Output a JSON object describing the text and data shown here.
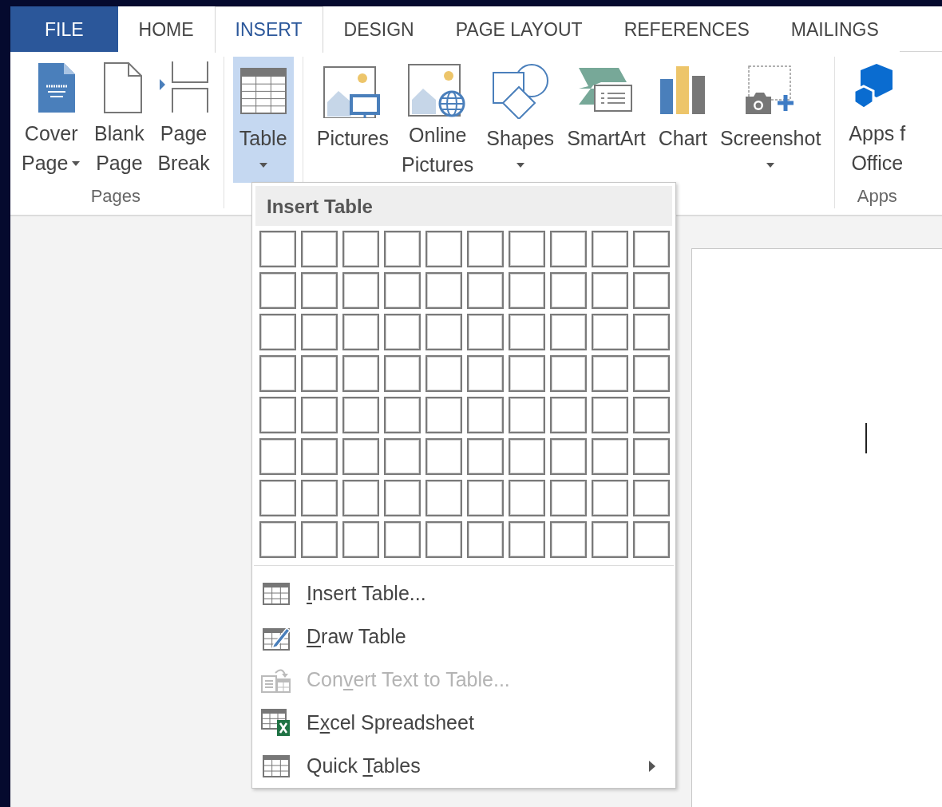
{
  "tabs": [
    {
      "label": "FILE",
      "kind": "file",
      "selected": false
    },
    {
      "label": "HOME",
      "kind": "tab",
      "selected": false
    },
    {
      "label": "INSERT",
      "kind": "tab",
      "selected": true
    },
    {
      "label": "DESIGN",
      "kind": "tab",
      "selected": false
    },
    {
      "label": "PAGE LAYOUT",
      "kind": "tab",
      "selected": false
    },
    {
      "label": "REFERENCES",
      "kind": "tab",
      "selected": false
    },
    {
      "label": "MAILINGS",
      "kind": "tab",
      "selected": false
    }
  ],
  "ribbon": {
    "groups": [
      {
        "label": "Pages",
        "buttons": [
          {
            "lines": [
              "Cover",
              "Page"
            ],
            "dropdown": true,
            "pressed": false
          },
          {
            "lines": [
              "Blank",
              "Page"
            ],
            "dropdown": false,
            "pressed": false
          },
          {
            "lines": [
              "Page",
              "Break"
            ],
            "dropdown": false,
            "pressed": false
          }
        ]
      },
      {
        "buttons": [
          {
            "lines": [
              "Table"
            ],
            "dropdown": true,
            "pressed": true
          }
        ]
      },
      {
        "buttons": [
          {
            "lines": [
              "Pictures"
            ],
            "dropdown": false,
            "pressed": false
          },
          {
            "lines": [
              "Online",
              "Pictures"
            ],
            "dropdown": false,
            "pressed": false
          },
          {
            "lines": [
              "Shapes"
            ],
            "dropdown": true,
            "pressed": false
          },
          {
            "lines": [
              "SmartArt"
            ],
            "dropdown": false,
            "pressed": false
          },
          {
            "lines": [
              "Chart"
            ],
            "dropdown": false,
            "pressed": false
          },
          {
            "lines": [
              "Screenshot"
            ],
            "dropdown": true,
            "pressed": false
          }
        ]
      },
      {
        "label": "Apps",
        "buttons": [
          {
            "lines": [
              "Apps f",
              "Office"
            ],
            "dropdown": false,
            "pressed": false
          }
        ]
      }
    ]
  },
  "table_menu": {
    "title": "Insert Table",
    "grid": [
      {
        "cells": [
          {
            "selected": false
          },
          {
            "selected": false
          },
          {
            "selected": false
          },
          {
            "selected": false
          },
          {
            "selected": false
          },
          {
            "selected": false
          },
          {
            "selected": false
          },
          {
            "selected": false
          },
          {
            "selected": false
          },
          {
            "selected": false
          }
        ]
      },
      {
        "cells": [
          {
            "selected": false
          },
          {
            "selected": false
          },
          {
            "selected": false
          },
          {
            "selected": false
          },
          {
            "selected": false
          },
          {
            "selected": false
          },
          {
            "selected": false
          },
          {
            "selected": false
          },
          {
            "selected": false
          },
          {
            "selected": false
          }
        ]
      },
      {
        "cells": [
          {
            "selected": false
          },
          {
            "selected": false
          },
          {
            "selected": false
          },
          {
            "selected": false
          },
          {
            "selected": false
          },
          {
            "selected": false
          },
          {
            "selected": false
          },
          {
            "selected": false
          },
          {
            "selected": false
          },
          {
            "selected": false
          }
        ]
      },
      {
        "cells": [
          {
            "selected": false
          },
          {
            "selected": false
          },
          {
            "selected": false
          },
          {
            "selected": false
          },
          {
            "selected": false
          },
          {
            "selected": false
          },
          {
            "selected": false
          },
          {
            "selected": false
          },
          {
            "selected": false
          },
          {
            "selected": false
          }
        ]
      },
      {
        "cells": [
          {
            "selected": false
          },
          {
            "selected": false
          },
          {
            "selected": false
          },
          {
            "selected": false
          },
          {
            "selected": false
          },
          {
            "selected": false
          },
          {
            "selected": false
          },
          {
            "selected": false
          },
          {
            "selected": false
          },
          {
            "selected": false
          }
        ]
      },
      {
        "cells": [
          {
            "selected": false
          },
          {
            "selected": false
          },
          {
            "selected": false
          },
          {
            "selected": false
          },
          {
            "selected": false
          },
          {
            "selected": false
          },
          {
            "selected": false
          },
          {
            "selected": false
          },
          {
            "selected": false
          },
          {
            "selected": false
          }
        ]
      },
      {
        "cells": [
          {
            "selected": false
          },
          {
            "selected": false
          },
          {
            "selected": false
          },
          {
            "selected": false
          },
          {
            "selected": false
          },
          {
            "selected": false
          },
          {
            "selected": false
          },
          {
            "selected": false
          },
          {
            "selected": false
          },
          {
            "selected": false
          }
        ]
      },
      {
        "cells": [
          {
            "selected": false
          },
          {
            "selected": false
          },
          {
            "selected": false
          },
          {
            "selected": false
          },
          {
            "selected": false
          },
          {
            "selected": false
          },
          {
            "selected": false
          },
          {
            "selected": false
          },
          {
            "selected": false
          },
          {
            "selected": false
          }
        ]
      }
    ],
    "items": [
      {
        "key": "I",
        "after": "nsert Table...",
        "disabled": false,
        "submenu": false
      },
      {
        "key": "D",
        "after": "raw Table",
        "disabled": false,
        "submenu": false
      },
      {
        "before": "Con",
        "key": "v",
        "after": "ert Text to Table...",
        "disabled": true,
        "submenu": false
      },
      {
        "before": "E",
        "key": "x",
        "after": "cel Spreadsheet",
        "disabled": false,
        "submenu": false
      },
      {
        "before": "Quick ",
        "key": "T",
        "after": "ables",
        "disabled": false,
        "submenu": true
      }
    ]
  }
}
